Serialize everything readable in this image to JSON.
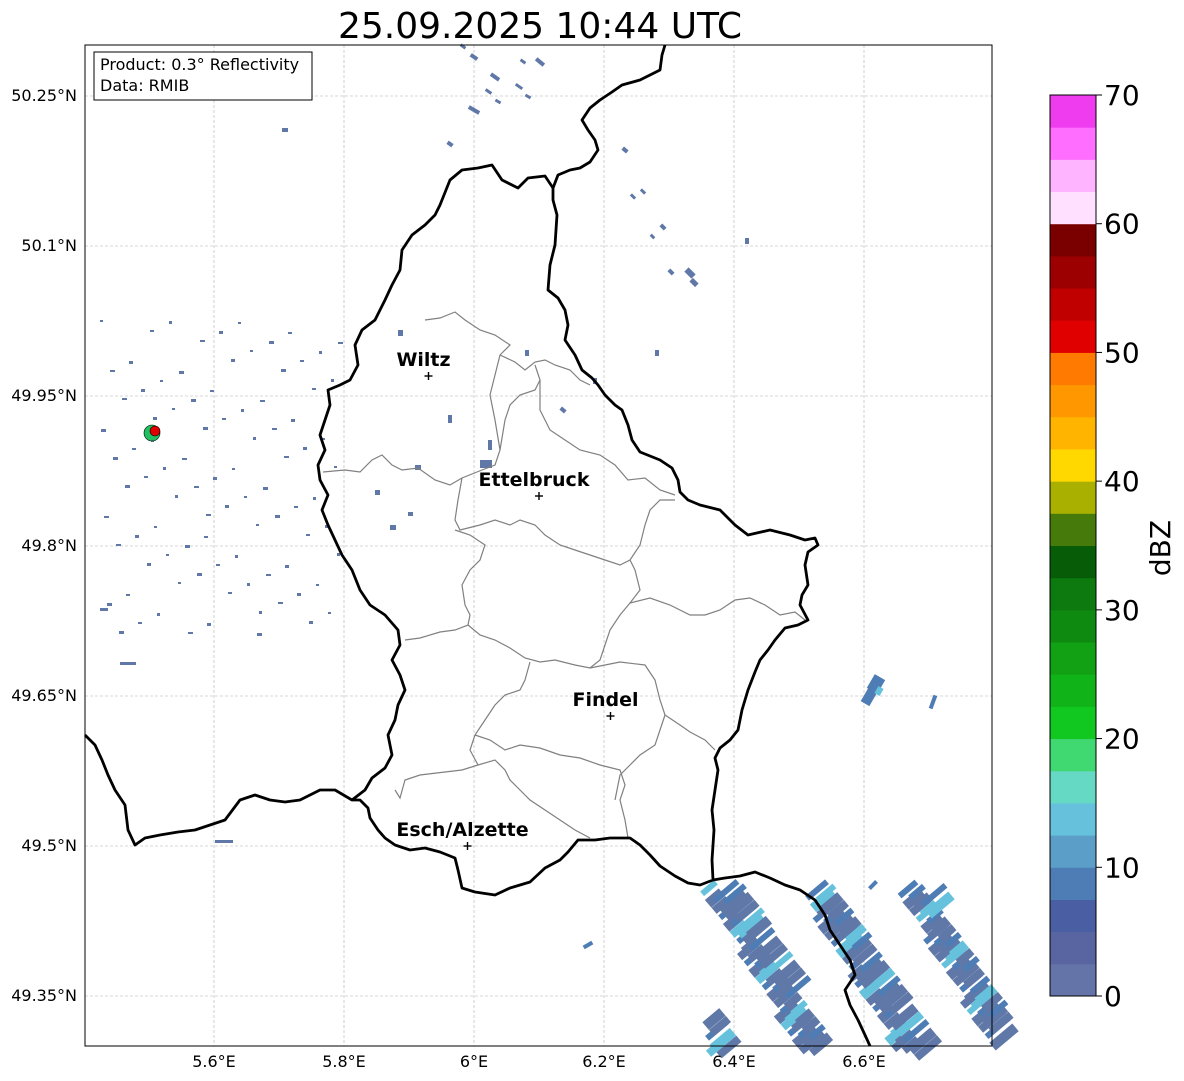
{
  "title": "25.09.2025 10:44 UTC",
  "info_box": {
    "product": "Product: 0.3° Reflectivity",
    "data_source": "Data: RMIB"
  },
  "map": {
    "lat_labels": [
      "50.25°N",
      "50.1°N",
      "49.95°N",
      "49.8°N",
      "49.65°N",
      "49.5°N",
      "49.35°N"
    ],
    "lon_labels": [
      "5.6°E",
      "5.8°E",
      "6°E",
      "6.2°E",
      "6.4°E",
      "6.6°E"
    ],
    "grid": true,
    "cities": [
      {
        "name": "Wiltz",
        "lon": 5.93,
        "lat": 49.97
      },
      {
        "name": "Ettelbruck",
        "lon": 6.1,
        "lat": 49.85
      },
      {
        "name": "Findel",
        "lon": 6.21,
        "lat": 49.63
      },
      {
        "name": "Esch/Alzette",
        "lon": 5.99,
        "lat": 49.5
      }
    ]
  },
  "colorbar": {
    "label": "dBZ",
    "ticks": [
      "70",
      "60",
      "50",
      "40",
      "30",
      "20",
      "10",
      "0"
    ],
    "min": 0,
    "max": 70,
    "colors": [
      "#6474a8",
      "#5865a0",
      "#4a5fa3",
      "#4e7db5",
      "#5b9ec8",
      "#66c2dc",
      "#66d9c4",
      "#40d870",
      "#10c820",
      "#10b418",
      "#12a014",
      "#0f8a10",
      "#0c7a0e",
      "#075c08",
      "#467a0a",
      "#aab000",
      "#ffd800",
      "#ffb400",
      "#ff9800",
      "#ff7a00",
      "#e00000",
      "#c00000",
      "#9c0000",
      "#7a0000",
      "#ffe0ff",
      "#ffb4ff",
      "#ff6eff",
      "#ee3cee"
    ]
  },
  "colors": {
    "border": "#000000",
    "district": "#808080",
    "echo_light": "#6078a8",
    "echo_medium": "#4e7db5",
    "echo_bright": "#66c2dc"
  }
}
